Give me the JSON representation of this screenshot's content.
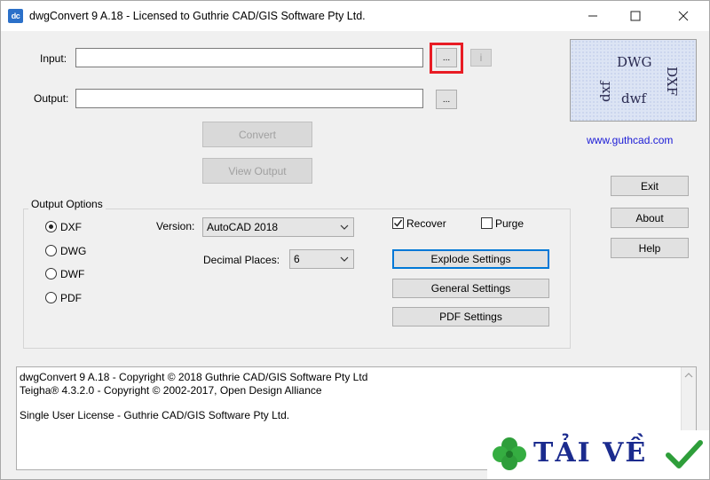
{
  "window": {
    "title": "dwgConvert 9 A.18 - Licensed to Guthrie CAD/GIS Software Pty Ltd.",
    "icon_text": "dc"
  },
  "io": {
    "input_label": "Input:",
    "input_value": "",
    "browse_input_label": "...",
    "info_label": "i",
    "output_label": "Output:",
    "output_value": "",
    "browse_output_label": "...",
    "convert_label": "Convert",
    "view_output_label": "View Output"
  },
  "logo": {
    "words": [
      "DWG",
      "DXF",
      "dxf",
      "dwf"
    ],
    "link": "www.guthcad.com"
  },
  "side_buttons": {
    "exit": "Exit",
    "about": "About",
    "help": "Help"
  },
  "output_options": {
    "title": "Output Options",
    "formats": [
      {
        "label": "DXF",
        "checked": true
      },
      {
        "label": "DWG",
        "checked": false
      },
      {
        "label": "DWF",
        "checked": false
      },
      {
        "label": "PDF",
        "checked": false
      }
    ],
    "version_label": "Version:",
    "version_value": "AutoCAD 2018",
    "decimal_label": "Decimal Places:",
    "decimal_value": "6",
    "recover_label": "Recover",
    "recover_checked": true,
    "purge_label": "Purge",
    "purge_checked": false,
    "explode_settings": "Explode Settings",
    "general_settings": "General Settings",
    "pdf_settings": "PDF Settings"
  },
  "info": {
    "lines": [
      "dwgConvert 9 A.18 - Copyright © 2018 Guthrie CAD/GIS Software Pty Ltd",
      "Teigha® 4.3.2.0 - Copyright © 2002-2017, Open Design Alliance",
      "",
      "Single User License - Guthrie CAD/GIS Software Pty Ltd."
    ]
  },
  "watermark": {
    "text": "TẢI VỀ"
  },
  "colors": {
    "highlight": "#e81c24",
    "link": "#1a1ad6",
    "focus": "#0078d7"
  }
}
